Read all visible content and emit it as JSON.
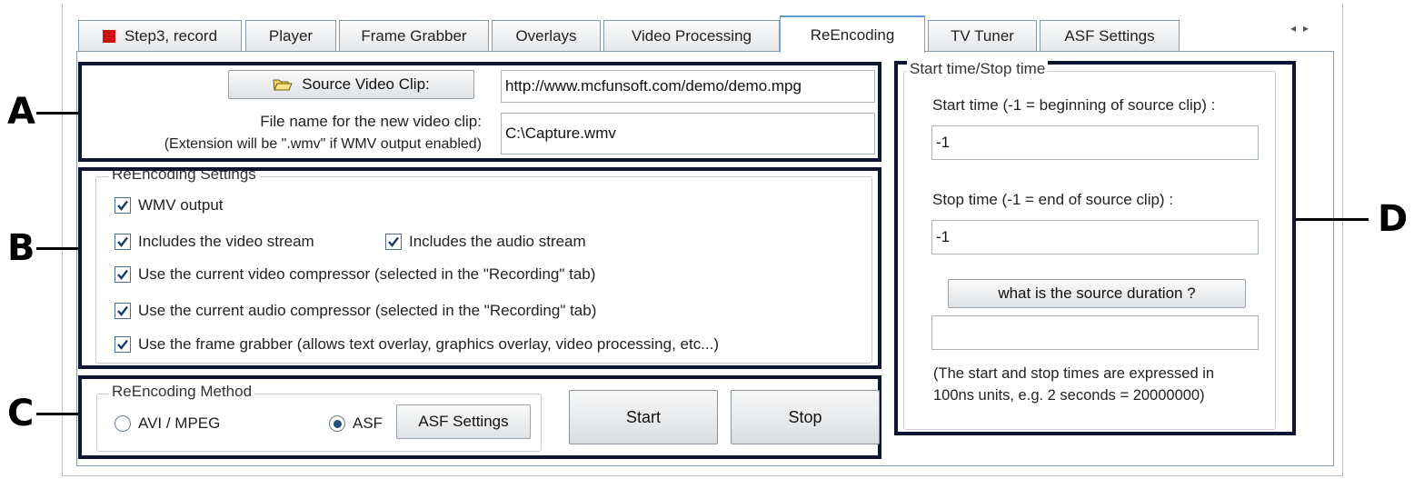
{
  "tabs": [
    {
      "label": "Step3, record",
      "active": false
    },
    {
      "label": "Player",
      "active": false
    },
    {
      "label": "Frame Grabber",
      "active": false
    },
    {
      "label": "Overlays",
      "active": false
    },
    {
      "label": "Video Processing",
      "active": false
    },
    {
      "label": "ReEncoding",
      "active": true
    },
    {
      "label": "TV Tuner",
      "active": false
    },
    {
      "label": "ASF Settings",
      "active": false
    }
  ],
  "tab_scroll": {
    "left": "◂",
    "right": "▸"
  },
  "callouts": {
    "a": "A",
    "b": "B",
    "c": "C",
    "d": "D"
  },
  "section_a": {
    "source_button_label": "Source Video Clip:",
    "source_url": "http://www.mcfunsoft.com/demo/demo.mpg",
    "file_label_line1": "File name for the new video clip:",
    "file_label_line2": "(Extension will be \".wmv\" if WMV output enabled)",
    "file_value": "C:\\Capture.wmv"
  },
  "section_b": {
    "group_title": "ReEncoding Settings",
    "options": [
      {
        "label": "WMV output",
        "checked": true
      },
      {
        "label": "Includes the video stream",
        "checked": true
      },
      {
        "label": "Includes the audio stream",
        "checked": true
      },
      {
        "label": "Use the current video compressor (selected in the \"Recording\" tab)",
        "checked": true
      },
      {
        "label": "Use the current audio compressor (selected in the \"Recording\" tab)",
        "checked": true
      },
      {
        "label": "Use the frame grabber (allows text overlay, graphics overlay, video processing, etc...)",
        "checked": true
      }
    ]
  },
  "section_c": {
    "group_title": "ReEncoding Method",
    "radio_avi": {
      "label": "AVI / MPEG",
      "selected": false
    },
    "radio_asf": {
      "label": "ASF",
      "selected": true
    },
    "asf_settings_label": "ASF Settings",
    "start_label": "Start",
    "stop_label": "Stop"
  },
  "section_d": {
    "group_title": "Start time/Stop time",
    "start_label": "Start time (-1 = beginning of source clip) :",
    "start_value": "-1",
    "stop_label": "Stop time (-1 = end of source clip) :",
    "stop_value": "-1",
    "duration_button": "what is the source duration ?",
    "duration_value": "",
    "note_line1": "(The start and stop times are expressed in",
    "note_line2": "100ns units, e.g. 2 seconds = 20000000)"
  },
  "colors": {
    "callout_border": "#0d1530",
    "record_icon": "#cc1111",
    "active_tab_accent": "#5d9cd3"
  }
}
